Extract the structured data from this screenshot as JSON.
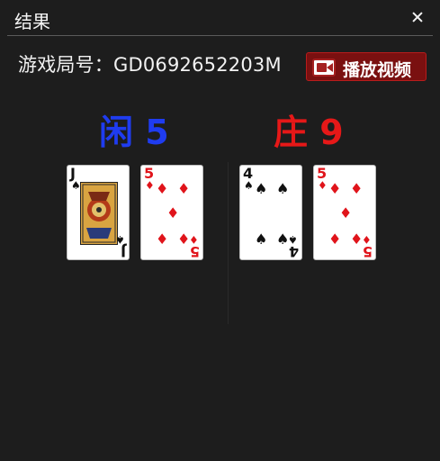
{
  "dialog": {
    "title": "结果",
    "round_line": "游戏局号：GD0692652203M",
    "video_button": "播放视频"
  },
  "player": {
    "title": "闲 5",
    "cards": [
      {
        "rank": "J",
        "suit": "spade"
      },
      {
        "rank": "5",
        "suit": "diamond"
      }
    ]
  },
  "banker": {
    "title": "庄 9",
    "cards": [
      {
        "rank": "4",
        "suit": "spade"
      },
      {
        "rank": "5",
        "suit": "diamond"
      }
    ]
  },
  "colors": {
    "player": "#1f3cf0",
    "banker": "#e61818",
    "video_button_bg": "#7a1010"
  },
  "card_symbols": {
    "spade": "♠",
    "diamond": "♦"
  }
}
